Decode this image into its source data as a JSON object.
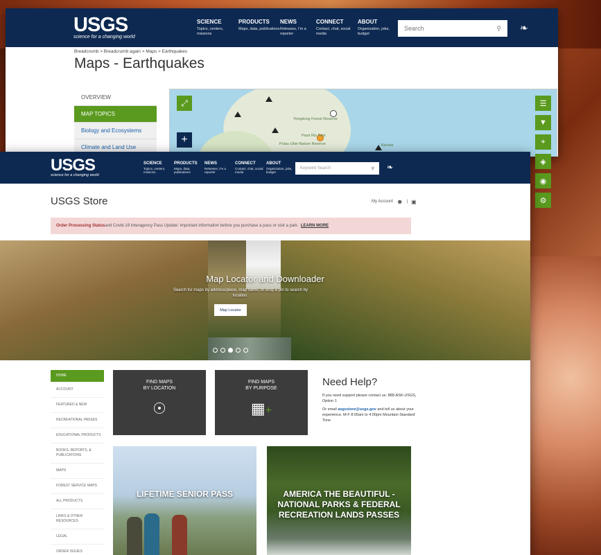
{
  "back_window": {
    "logo": {
      "mark": "USGS",
      "tagline": "science for a changing world"
    },
    "nav": [
      {
        "title": "SCIENCE",
        "sub": "Topics, centers, missions"
      },
      {
        "title": "PRODUCTS",
        "sub": "Maps, data, publications"
      },
      {
        "title": "NEWS",
        "sub": "Releases, I'm a reporter"
      },
      {
        "title": "CONNECT",
        "sub": "Contact, chat, social media"
      },
      {
        "title": "ABOUT",
        "sub": "Organization, jobs, budget"
      }
    ],
    "search_placeholder": "Search",
    "breadcrumb": "Breadcrumb  >  Breadcrumb again  >  Maps  >  Earthquakes",
    "title": "Maps - Earthquakes",
    "sidenav": [
      {
        "label": "OVERVIEW"
      },
      {
        "label": "MAP TOPICS"
      },
      {
        "label": "Biology and Ecosystems"
      },
      {
        "label": "Climate and Land Use"
      }
    ],
    "map_labels": [
      "Yongdong Forest Reserve",
      "Pulau Ubin Nature Reserve",
      "Pasir Ris Park",
      "Bandar"
    ]
  },
  "store": {
    "logo": {
      "mark": "USGS",
      "tagline": "science for a changing world"
    },
    "nav": [
      {
        "title": "SCIENCE",
        "sub": "Topics, centers, missions"
      },
      {
        "title": "PRODUCTS",
        "sub": "Maps, data, publications"
      },
      {
        "title": "NEWS",
        "sub": "Releases, I'm a reporter"
      },
      {
        "title": "CONNECT",
        "sub": "Contact, chat, social media"
      },
      {
        "title": "ABOUT",
        "sub": "Organization, jobs, budget"
      }
    ],
    "search_placeholder": "Keyword Search",
    "page_title": "USGS Store",
    "account_label": "My Account",
    "alert": {
      "bold": "Order Processing Status",
      "text": " and Covid-19 Interagency Pass Update: Important information before you purchase a pass or visit a park.",
      "link": "LEARN MORE"
    },
    "hero": {
      "title": "Map Locator and Downloader",
      "subtitle": "Search for maps by address/place, map name, or drop a pin to search by location.",
      "button": "Map Locator"
    },
    "sidenav": [
      {
        "label": "HOME"
      },
      {
        "label": "ACCOUNT"
      },
      {
        "label": "FEATURED & NEW"
      },
      {
        "label": "RECREATIONAL PASSES"
      },
      {
        "label": "EDUCATIONAL PRODUCTS"
      },
      {
        "label": "BOOKS, REPORTS, & PUBLICATIONS"
      },
      {
        "label": "MAPS"
      },
      {
        "label": "FOREST SERVICE MAPS"
      },
      {
        "label": "ALL PRODUCTS"
      },
      {
        "label": "LINKS & OTHER RESOURCES"
      },
      {
        "label": "LEGAL"
      },
      {
        "label": "ORDER ISSUES"
      }
    ],
    "tiles": [
      {
        "line1": "FIND MAPS",
        "line2": "BY LOCATION"
      },
      {
        "line1": "FIND MAPS",
        "line2": "BY PURPOSE"
      }
    ],
    "help": {
      "title": "Need Help?",
      "p1": "If you need support please contact us: 888-ASK-USGS, Option 1",
      "p2_pre": "Or email ",
      "email": "asgsstore@usgs.gov",
      "p2_post": " and tell us about your experience. M-F 8:00am to 4:00pm Mountain Standard Time"
    },
    "passes": [
      {
        "title": "LIFETIME SENIOR PASS"
      },
      {
        "title": "AMERICA THE BEAUTIFUL - NATIONAL PARKS & FEDERAL RECREATION LANDS PASSES"
      }
    ]
  }
}
